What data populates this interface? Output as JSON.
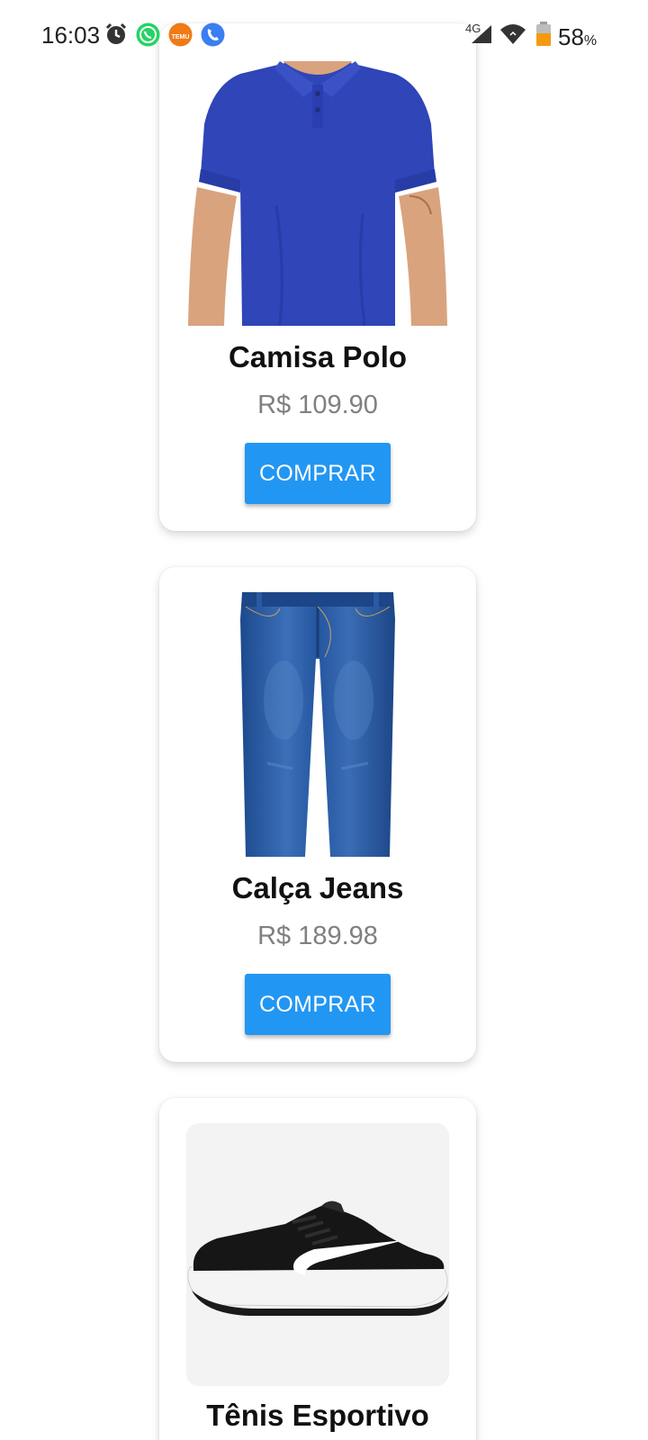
{
  "status_bar": {
    "time": "16:03",
    "network": "4G",
    "battery_percent": "58",
    "battery_symbol": "%",
    "icons": [
      "alarm-icon",
      "whatsapp-icon",
      "temu-icon",
      "phone-icon",
      "cell-signal-icon",
      "wifi-icon",
      "battery-icon"
    ],
    "temu_badge": "TEMU"
  },
  "products": [
    {
      "name": "Camisa Polo",
      "price": "R$ 109.90",
      "button": "COMPRAR"
    },
    {
      "name": "Calça Jeans",
      "price": "R$ 189.98",
      "button": "COMPRAR"
    },
    {
      "name": "Tênis Esportivo"
    }
  ],
  "colors": {
    "button": "#2296f3",
    "price": "#808080",
    "polo_shirt": "#2f45b8",
    "jeans": "#2556a0",
    "battery": "#f59a10"
  }
}
